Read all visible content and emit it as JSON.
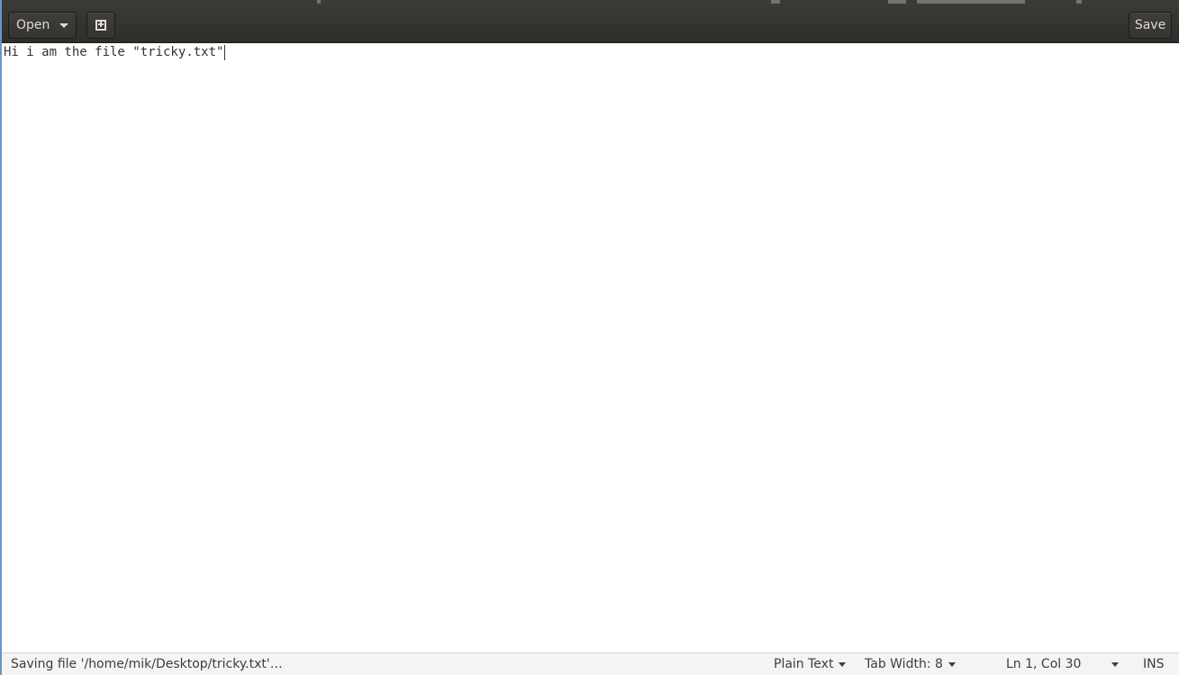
{
  "headerbar": {
    "open_label": "Open",
    "save_label": "Save",
    "new_tab_icon": "new-tab-icon",
    "open_dropdown_icon": "chevron-down-icon"
  },
  "editor": {
    "lines": [
      "Hi i am the file \"tricky.txt\""
    ]
  },
  "statusbar": {
    "message": "Saving file '/home/mik/Desktop/tricky.txt'…",
    "language": "Plain Text",
    "tab_width": "Tab Width: 8",
    "position": "Ln 1, Col 30",
    "mode": "INS"
  },
  "colors": {
    "headerbar_bg": "#3c3b37",
    "text": "#2e3436",
    "statusbar_bg": "#f5f4f2"
  }
}
